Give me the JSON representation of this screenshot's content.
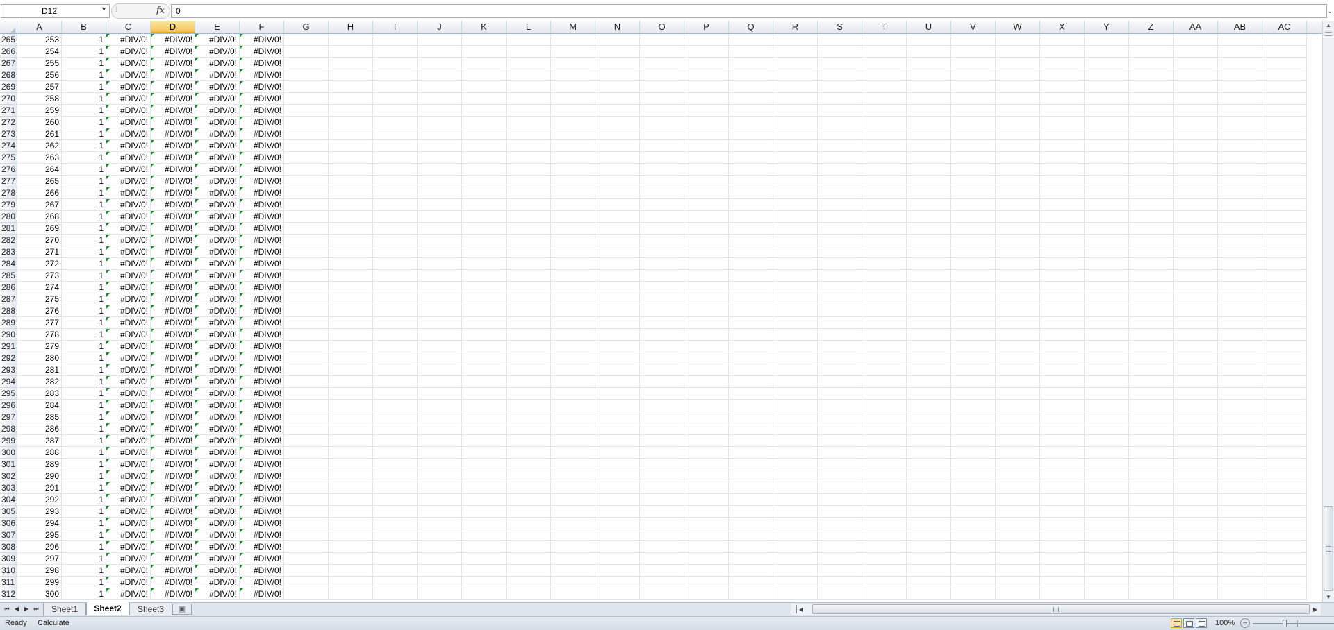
{
  "formula_bar": {
    "name_box": "D12",
    "fx_label": "fx",
    "formula": "0"
  },
  "columns": [
    "A",
    "B",
    "C",
    "D",
    "E",
    "F",
    "G",
    "H",
    "I",
    "J",
    "K",
    "L",
    "M",
    "N",
    "O",
    "P",
    "Q",
    "R",
    "S",
    "T",
    "U",
    "V",
    "W",
    "X",
    "Y",
    "Z",
    "AA",
    "AB",
    "AC"
  ],
  "active_column": "D",
  "rows": {
    "first_row_number": 265,
    "last_row_number": 312,
    "first_a_value": 253,
    "b_value": "1",
    "error_value": "#DIV/0!"
  },
  "sheet_tabs": [
    {
      "label": "Sheet1",
      "active": false
    },
    {
      "label": "Sheet2",
      "active": true
    },
    {
      "label": "Sheet3",
      "active": false
    }
  ],
  "status_bar": {
    "mode": "Ready",
    "calculate": "Calculate",
    "zoom": "100%"
  },
  "colors": {
    "error_triangle": "#1e8a2c",
    "active_header": "#f3c353",
    "gridline": "#e1e5ee",
    "header_border": "#9eb6ce"
  }
}
